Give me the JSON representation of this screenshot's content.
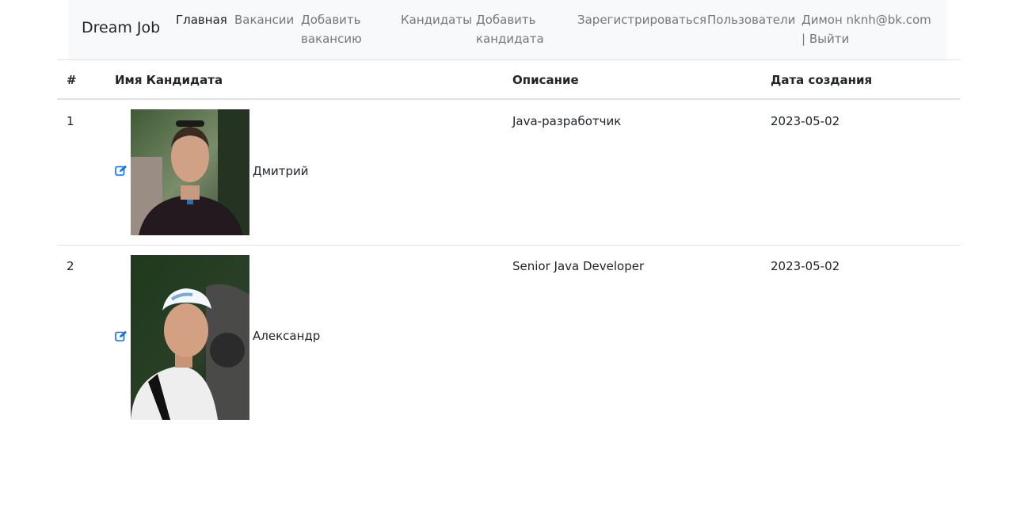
{
  "navbar": {
    "brand": "Dream Job",
    "links": [
      {
        "label": "Главная",
        "active": true
      },
      {
        "label": "Вакансии",
        "active": false
      },
      {
        "label": "Добавить вакансию",
        "active": false
      },
      {
        "label": "Кандидаты",
        "active": false
      },
      {
        "label": "Добавить кандидата",
        "active": false
      },
      {
        "label": "Зарегистрироваться",
        "active": false
      },
      {
        "label": "Пользователи",
        "active": false
      }
    ],
    "user": "Димон nknh@bk.com | Выйти"
  },
  "table": {
    "headers": [
      "#",
      "Имя Кандидата",
      "Описание",
      "Дата создания"
    ],
    "rows": [
      {
        "id": "1",
        "name": "Дмитрий",
        "description": "Java-разработчик",
        "created": "2023-05-02"
      },
      {
        "id": "2",
        "name": "Александр",
        "description": "Senior Java Developer",
        "created": "2023-05-02"
      }
    ]
  },
  "icons": {
    "edit": "edit-icon",
    "photo": "candidate-photo"
  },
  "colors": {
    "navbar_bg": "#f8f9fa",
    "link": "#777777",
    "link_active": "#1f1f1f",
    "edit_icon": "#0d6efd",
    "border": "#dee2e6"
  }
}
